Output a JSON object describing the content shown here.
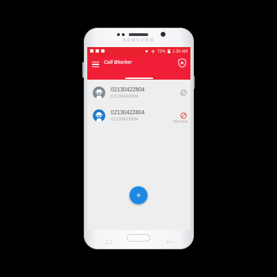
{
  "device": {
    "brand": "SAMSUNG"
  },
  "status_bar": {
    "battery": "72%",
    "time": "1:30 AM"
  },
  "app_bar": {
    "title": "Call Blocker"
  },
  "contacts": [
    {
      "number": "02130422804",
      "subtitle": "02130422804",
      "status": ""
    },
    {
      "number": "02130422804",
      "subtitle": "02130422804",
      "status": "Blocking"
    }
  ],
  "fab": {
    "label": "+"
  },
  "colors": {
    "primary": "#f01e37",
    "status_bar": "#e8202f",
    "fab": "#1e88e5",
    "avatar_grey": "#7d8a96",
    "avatar_blue": "#1e78c8",
    "block_grey": "#9e9e9e",
    "block_red": "#e53935"
  }
}
